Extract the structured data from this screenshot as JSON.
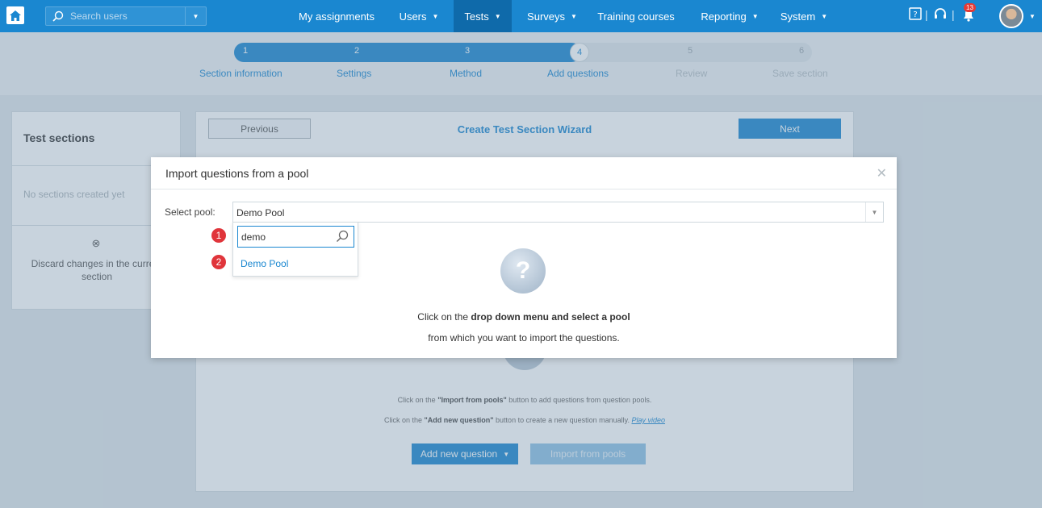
{
  "nav": {
    "search_placeholder": "Search users",
    "items": [
      {
        "label": "My assignments"
      },
      {
        "label": "Users"
      },
      {
        "label": "Tests"
      },
      {
        "label": "Surveys"
      },
      {
        "label": "Training courses"
      },
      {
        "label": "Reporting"
      },
      {
        "label": "System"
      }
    ],
    "notifications_count": "13"
  },
  "stepper": {
    "steps": [
      {
        "num": "1",
        "label": "Section information"
      },
      {
        "num": "2",
        "label": "Settings"
      },
      {
        "num": "3",
        "label": "Method"
      },
      {
        "num": "4",
        "label": "Add questions"
      },
      {
        "num": "5",
        "label": "Review"
      },
      {
        "num": "6",
        "label": "Save section"
      }
    ],
    "current_step": 4
  },
  "sidebar": {
    "title": "Test sections",
    "empty_text": "No sections created yet",
    "discard_label": "Discard changes in the current section"
  },
  "wizard": {
    "previous_label": "Previous",
    "title": "Create Test Section Wizard",
    "next_label": "Next",
    "hint_import_pre": "Click on the ",
    "hint_import_bold": "\"Import from pools\"",
    "hint_import_post": " button to add questions from question pools.",
    "hint_new_pre": "Click on the ",
    "hint_new_bold": "\"Add new question\"",
    "hint_new_post": " button to create a new question manually. ",
    "play_video": "Play video",
    "add_new_label": "Add new question",
    "import_label": "Import from pools"
  },
  "modal": {
    "title": "Import questions from a pool",
    "select_label": "Select pool:",
    "selected_value": "Demo Pool",
    "search_value": "demo",
    "options": [
      "Demo Pool"
    ],
    "marker_1": "1",
    "marker_2": "2",
    "help_pre": "Click on the ",
    "help_bold": "drop down menu and select a pool",
    "help_line2": "from which you want to import the questions."
  }
}
